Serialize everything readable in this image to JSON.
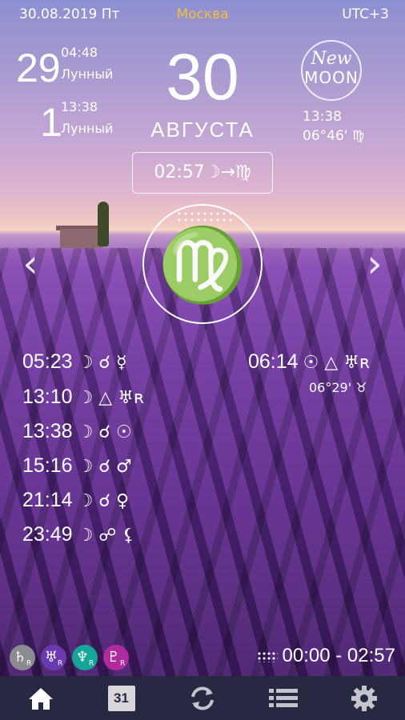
{
  "header": {
    "date": "30.08.2019 Пт",
    "city": "Москва",
    "timezone": "UTC+3"
  },
  "lunar_days": [
    {
      "day": "29",
      "time": "04:48",
      "label": "Лунный"
    },
    {
      "day": "1",
      "time": "13:38",
      "label": "Лунный"
    }
  ],
  "main_date": {
    "day": "30",
    "month": "АВГУСТА"
  },
  "moon_phase": {
    "line1": "New",
    "line2": "MOON",
    "time": "13:38",
    "position": "06°46' ♍"
  },
  "moon_ingress": "02:57☽→♍",
  "zodiac_sign": {
    "glyph": "♍",
    "name": "virgo"
  },
  "aspects_left": [
    {
      "time": "05:23",
      "symbols": "☽ ☌ ☿"
    },
    {
      "time": "13:10",
      "symbols": "☽ △ ♅ʀ"
    },
    {
      "time": "13:38",
      "symbols": "☽ ☌ ☉"
    },
    {
      "time": "15:16",
      "symbols": "☽ ☌ ♂"
    },
    {
      "time": "21:14",
      "symbols": "☽ ☌ ♀"
    },
    {
      "time": "23:49",
      "symbols": "☽ ☍ ⚸"
    }
  ],
  "aspect_right": {
    "time": "06:14",
    "symbols": "☉ △ ♅ʀ",
    "position": "06°29' ♉"
  },
  "retrogrades": [
    {
      "planet": "♄",
      "r": "R"
    },
    {
      "planet": "♅",
      "r": "R"
    },
    {
      "planet": "♆",
      "r": "R"
    },
    {
      "planet": "♇",
      "r": "R"
    }
  ],
  "void_of_course": "00:00 - 02:57",
  "nav": {
    "items": [
      {
        "name": "home-icon"
      },
      {
        "name": "calendar-icon",
        "label": "31"
      },
      {
        "name": "refresh-icon"
      },
      {
        "name": "list-icon"
      },
      {
        "name": "settings-icon"
      }
    ]
  },
  "colors": {
    "accent_city": "#f0c040",
    "nav_bg": "#272842",
    "nav_active": "#ffffff",
    "nav_inactive": "#c4c4cc"
  }
}
